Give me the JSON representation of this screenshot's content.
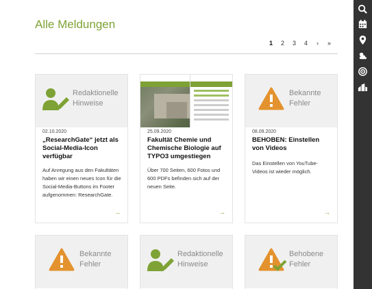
{
  "page": {
    "title": "Alle Meldungen"
  },
  "pagination": {
    "pages": [
      "1",
      "2",
      "3",
      "4"
    ],
    "current": "1",
    "next": "›",
    "last": "»"
  },
  "cards": [
    {
      "category_lines": [
        "Redaktionelle",
        "Hinweise"
      ],
      "icon": "editorial-notes-icon",
      "date": "02.10.2020",
      "title": "„ResearchGate“ jetzt als Social-Media-Icon verfügbar",
      "text": "Auf Anregung aus den Fakultäten haben wir einen neues Icon für die Social-Media-Buttons im Footer aufgenommen: ResearchGate.",
      "more": "→"
    },
    {
      "category_lines": [],
      "icon": "faculty-photo",
      "date": "25.09.2020",
      "title": "Fakultät Chemie und Chemische Biologie auf TYPO3 umgestiegen",
      "text": "Über 700 Seiten, 600 Fotos und 600 PDFs befinden sich auf der neuen Seite.",
      "more": "→"
    },
    {
      "category_lines": [
        "Bekannte",
        "Fehler"
      ],
      "icon": "warning-icon",
      "date": "08.09.2020",
      "title": "BEHOBEN: Einstellen von Videos",
      "text": "Das Einstellen von YouTube-Videos ist wieder möglich.",
      "more": "→"
    },
    {
      "category_lines": [
        "Bekannte",
        "Fehler"
      ],
      "icon": "warning-icon"
    },
    {
      "category_lines": [
        "Redaktionelle",
        "Hinweise"
      ],
      "icon": "editorial-notes-icon"
    },
    {
      "category_lines": [
        "Behobene",
        "Fehler"
      ],
      "icon": "fixed-warning-icon"
    }
  ],
  "sidebar": {
    "icons": [
      "search-icon",
      "calendar-icon",
      "location-pin-icon",
      "weather-icon",
      "radio-icon",
      "buildings-icon"
    ]
  },
  "colors": {
    "accent": "#7ea235",
    "warning": "#e3922e",
    "sidebar": "#333333"
  }
}
